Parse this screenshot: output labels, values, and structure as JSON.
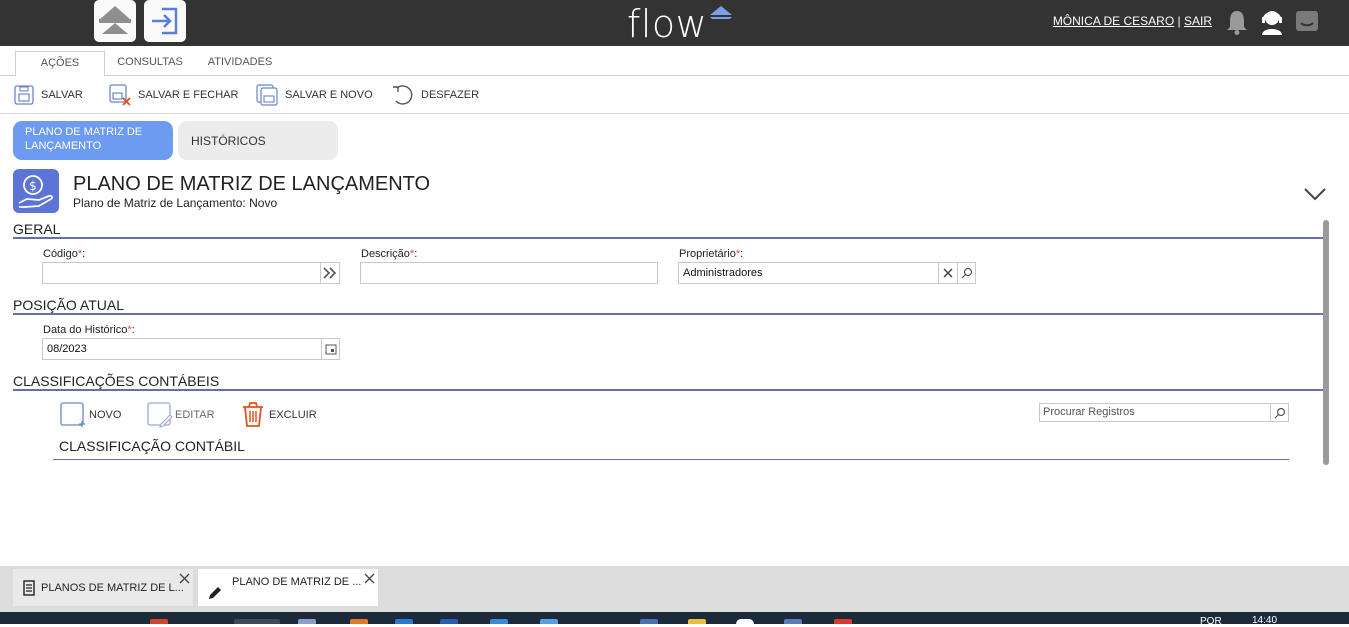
{
  "topbar": {
    "brand": "flow",
    "user_name": "MÔNICA DE CESARO",
    "separator": "|",
    "logout": "SAIR",
    "icons": [
      "cloud-icon",
      "login-icon",
      "bell-icon",
      "support-icon",
      "chat-icon"
    ]
  },
  "menu_tabs": [
    "AÇÕES",
    "CONSULTAS",
    "ATIVIDADES"
  ],
  "toolbar": {
    "save": "SALVAR",
    "save_close": "SALVAR E FECHAR",
    "save_new": "SALVAR E NOVO",
    "undo": "DESFAZER"
  },
  "form_tabs": {
    "active": "PLANO DE MATRIZ DE LANÇAMENTO",
    "inactive": "HISTÓRICOS"
  },
  "header": {
    "title": "PLANO DE MATRIZ DE LANÇAMENTO",
    "subtitle": "Plano de Matriz de Lançamento: Novo"
  },
  "sections": {
    "general": "GERAL",
    "position": "POSIÇÃO ATUAL",
    "classifications": "CLASSIFICAÇÕES CONTÁBEIS"
  },
  "fields": {
    "code_label": "Código",
    "code_value": "",
    "description_label": "Descrição",
    "description_value": "",
    "owner_label": "Proprietário",
    "owner_value": "Administradores",
    "history_date_label": "Data do Histórico",
    "history_date_value": "08/2023",
    "required_marker": "*",
    "colon": ":"
  },
  "grid": {
    "new": "NOVO",
    "edit": "EDITAR",
    "delete": "EXCLUIR",
    "search_placeholder": "Procurar Registros",
    "column_header": "CLASSIFICAÇÃO CONTÁBIL"
  },
  "bottom_tabs": [
    {
      "label": "PLANOS DE MATRIZ DE L...",
      "icon": "list-icon"
    },
    {
      "label": "PLANO DE MATRIZ DE ...",
      "icon": "pencil-icon"
    }
  ],
  "taskbar": {
    "lang": "POR",
    "time": "14:40"
  },
  "colors": {
    "accent": "#6d9bf1",
    "section_line": "#6a6ea8",
    "required": "#d94b3c",
    "topbar": "#333333",
    "delete": "#e0531f"
  }
}
